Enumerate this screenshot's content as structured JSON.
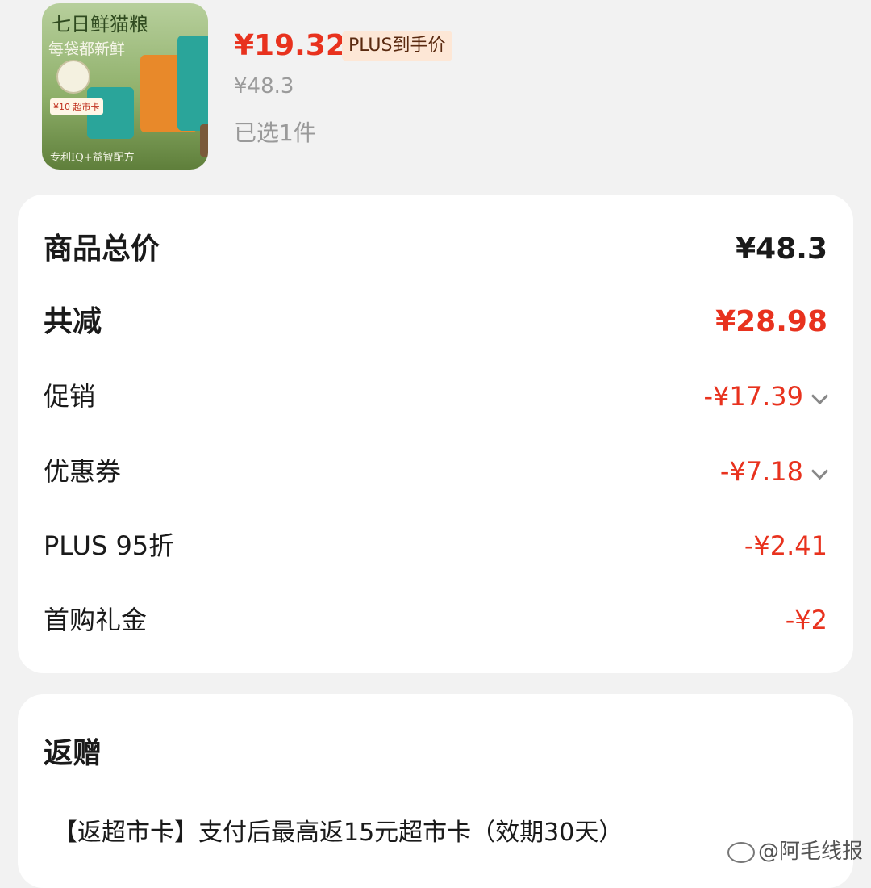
{
  "product": {
    "image_text": {
      "title": "七日鲜猫粮",
      "subtitle": "每袋都新鲜",
      "footer": "专利IQ+益智配方",
      "card": "¥10 超市卡"
    },
    "price_now": "¥19.32",
    "plus_tag": "PLUS到手价",
    "price_original": "¥48.3",
    "selected": "已选1件"
  },
  "summary": {
    "total": {
      "label": "商品总价",
      "value": "¥48.3"
    },
    "reduced": {
      "label": "共减",
      "value": "¥28.98"
    },
    "rows": [
      {
        "label": "促销",
        "value": "-¥17.39",
        "expandable": true
      },
      {
        "label": "优惠券",
        "value": "-¥7.18",
        "expandable": true
      },
      {
        "label": "PLUS 95折",
        "value": "-¥2.41",
        "expandable": false
      },
      {
        "label": "首购礼金",
        "value": "-¥2",
        "expandable": false
      }
    ]
  },
  "gift": {
    "title": "返赠",
    "text": "【返超市卡】支付后最高返15元超市卡（效期30天）"
  },
  "watermark": "@阿毛线报",
  "colors": {
    "accent_red": "#e8321e",
    "tag_bg": "#fde7d6",
    "background": "#f2f2f2"
  }
}
